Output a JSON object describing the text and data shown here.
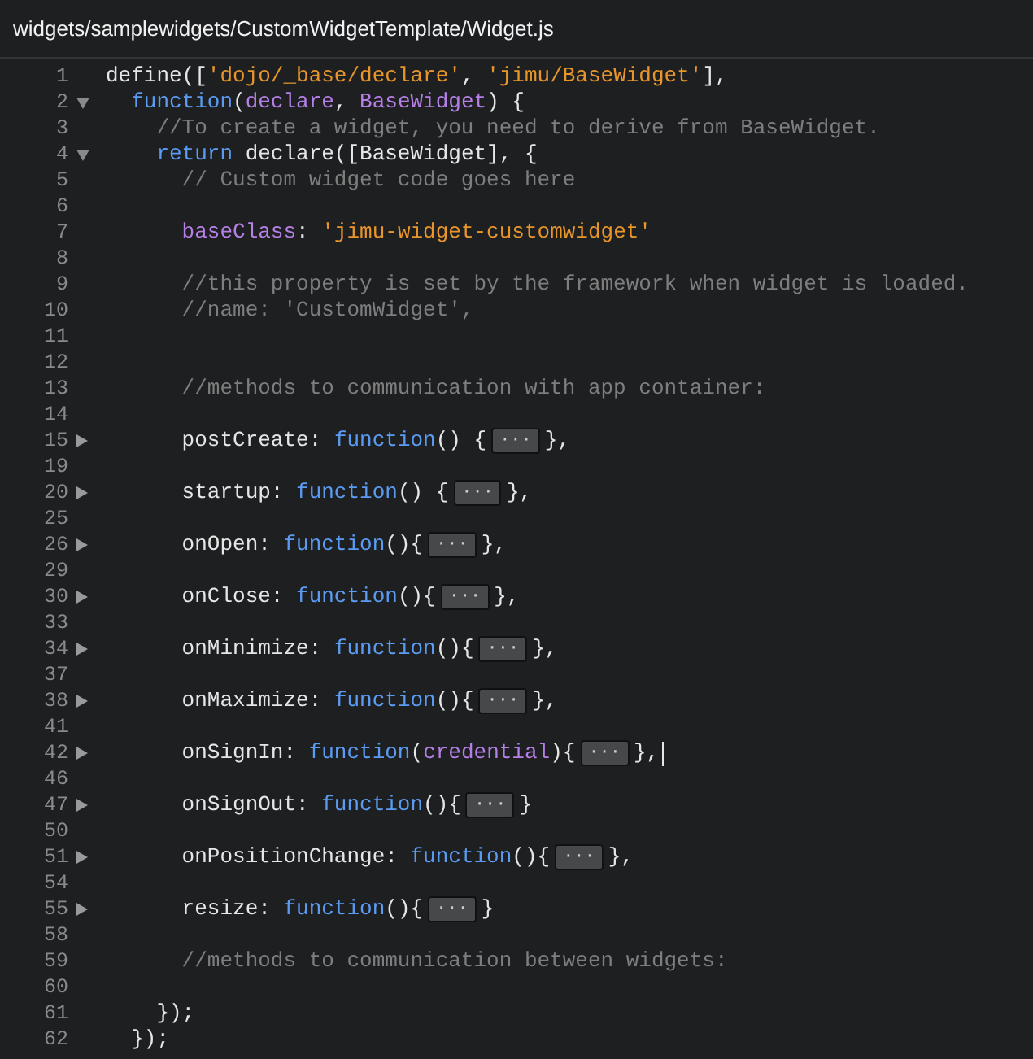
{
  "title": "widgets/samplewidgets/CustomWidgetTemplate/Widget.js",
  "lines": [
    {
      "num": "1",
      "tokens": [
        {
          "text": "define([",
          "kind": "plain"
        },
        {
          "text": "'dojo/_base/declare'",
          "kind": "string"
        },
        {
          "text": ", ",
          "kind": "plain"
        },
        {
          "text": "'jimu/BaseWidget'",
          "kind": "string"
        },
        {
          "text": "],",
          "kind": "plain"
        }
      ]
    },
    {
      "num": "2",
      "collapsed": false,
      "tokens": [
        {
          "text": "  function",
          "kind": "keyword"
        },
        {
          "text": "(",
          "kind": "plain"
        },
        {
          "text": "declare",
          "kind": "param"
        },
        {
          "text": ", ",
          "kind": "plain"
        },
        {
          "text": "BaseWidget",
          "kind": "param"
        },
        {
          "text": ") {",
          "kind": "plain"
        }
      ]
    },
    {
      "num": "3",
      "tokens": [
        {
          "text": "    //To create a widget, you need to derive from BaseWidget.",
          "kind": "comment"
        }
      ]
    },
    {
      "num": "4",
      "collapsed": false,
      "tokens": [
        {
          "text": "    return",
          "kind": "keyword"
        },
        {
          "text": " declare([BaseWidget], {",
          "kind": "plain"
        }
      ]
    },
    {
      "num": "5",
      "tokens": [
        {
          "text": "      // Custom widget code goes here",
          "kind": "comment"
        }
      ]
    },
    {
      "num": "6"
    },
    {
      "num": "7",
      "tokens": [
        {
          "text": "      baseClass",
          "kind": "prop"
        },
        {
          "text": ": ",
          "kind": "plain"
        },
        {
          "text": "'jimu-widget-customwidget'",
          "kind": "string"
        }
      ]
    },
    {
      "num": "8"
    },
    {
      "num": "9",
      "tokens": [
        {
          "text": "      //this property is set by the framework when widget is loaded.",
          "kind": "comment"
        }
      ]
    },
    {
      "num": "10",
      "tokens": [
        {
          "text": "      //name: 'CustomWidget',",
          "kind": "comment"
        }
      ]
    },
    {
      "num": "11"
    },
    {
      "num": "12"
    },
    {
      "num": "13",
      "tokens": [
        {
          "text": "      //methods to communication with app container:",
          "kind": "comment"
        }
      ]
    },
    {
      "num": "14"
    },
    {
      "num": "15",
      "collapsed": true,
      "tokens": [
        {
          "text": "      postCreate: ",
          "kind": "plain"
        },
        {
          "text": "function",
          "kind": "keyword"
        },
        {
          "text": "() {",
          "kind": "plain"
        },
        {
          "text": "···",
          "kind": "fold"
        },
        {
          "text": "},",
          "kind": "plain"
        }
      ]
    },
    {
      "num": "19"
    },
    {
      "num": "20",
      "collapsed": true,
      "tokens": [
        {
          "text": "      startup: ",
          "kind": "plain"
        },
        {
          "text": "function",
          "kind": "keyword"
        },
        {
          "text": "() {",
          "kind": "plain"
        },
        {
          "text": "···",
          "kind": "fold"
        },
        {
          "text": "},",
          "kind": "plain"
        }
      ]
    },
    {
      "num": "25"
    },
    {
      "num": "26",
      "collapsed": true,
      "tokens": [
        {
          "text": "      onOpen: ",
          "kind": "plain"
        },
        {
          "text": "function",
          "kind": "keyword"
        },
        {
          "text": "(){",
          "kind": "plain"
        },
        {
          "text": "···",
          "kind": "fold"
        },
        {
          "text": "},",
          "kind": "plain"
        }
      ]
    },
    {
      "num": "29"
    },
    {
      "num": "30",
      "collapsed": true,
      "tokens": [
        {
          "text": "      onClose: ",
          "kind": "plain"
        },
        {
          "text": "function",
          "kind": "keyword"
        },
        {
          "text": "(){",
          "kind": "plain"
        },
        {
          "text": "···",
          "kind": "fold"
        },
        {
          "text": "},",
          "kind": "plain"
        }
      ]
    },
    {
      "num": "33"
    },
    {
      "num": "34",
      "collapsed": true,
      "tokens": [
        {
          "text": "      onMinimize: ",
          "kind": "plain"
        },
        {
          "text": "function",
          "kind": "keyword"
        },
        {
          "text": "(){",
          "kind": "plain"
        },
        {
          "text": "···",
          "kind": "fold"
        },
        {
          "text": "},",
          "kind": "plain"
        }
      ]
    },
    {
      "num": "37"
    },
    {
      "num": "38",
      "collapsed": true,
      "tokens": [
        {
          "text": "      onMaximize: ",
          "kind": "plain"
        },
        {
          "text": "function",
          "kind": "keyword"
        },
        {
          "text": "(){",
          "kind": "plain"
        },
        {
          "text": "···",
          "kind": "fold"
        },
        {
          "text": "},",
          "kind": "plain"
        }
      ]
    },
    {
      "num": "41"
    },
    {
      "num": "42",
      "collapsed": true,
      "cursor": true,
      "tokens": [
        {
          "text": "      onSignIn: ",
          "kind": "plain"
        },
        {
          "text": "function",
          "kind": "keyword"
        },
        {
          "text": "(",
          "kind": "plain"
        },
        {
          "text": "credential",
          "kind": "param"
        },
        {
          "text": "){",
          "kind": "plain"
        },
        {
          "text": "···",
          "kind": "fold"
        },
        {
          "text": "},",
          "kind": "plain"
        }
      ]
    },
    {
      "num": "46"
    },
    {
      "num": "47",
      "collapsed": true,
      "tokens": [
        {
          "text": "      onSignOut: ",
          "kind": "plain"
        },
        {
          "text": "function",
          "kind": "keyword"
        },
        {
          "text": "(){",
          "kind": "plain"
        },
        {
          "text": "···",
          "kind": "fold"
        },
        {
          "text": "}",
          "kind": "plain"
        }
      ]
    },
    {
      "num": "50"
    },
    {
      "num": "51",
      "collapsed": true,
      "tokens": [
        {
          "text": "      onPositionChange: ",
          "kind": "plain"
        },
        {
          "text": "function",
          "kind": "keyword"
        },
        {
          "text": "(){",
          "kind": "plain"
        },
        {
          "text": "···",
          "kind": "fold"
        },
        {
          "text": "},",
          "kind": "plain"
        }
      ]
    },
    {
      "num": "54"
    },
    {
      "num": "55",
      "collapsed": true,
      "tokens": [
        {
          "text": "      resize: ",
          "kind": "plain"
        },
        {
          "text": "function",
          "kind": "keyword"
        },
        {
          "text": "(){",
          "kind": "plain"
        },
        {
          "text": "···",
          "kind": "fold"
        },
        {
          "text": "}",
          "kind": "plain"
        }
      ]
    },
    {
      "num": "58"
    },
    {
      "num": "59",
      "tokens": [
        {
          "text": "      //methods to communication between widgets:",
          "kind": "comment"
        }
      ]
    },
    {
      "num": "60"
    },
    {
      "num": "61",
      "tokens": [
        {
          "text": "    });",
          "kind": "plain"
        }
      ]
    },
    {
      "num": "62",
      "tokens": [
        {
          "text": "  });",
          "kind": "plain"
        }
      ]
    }
  ]
}
